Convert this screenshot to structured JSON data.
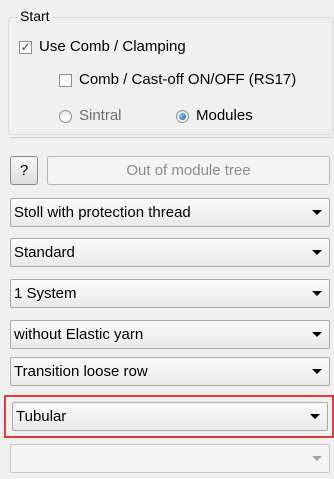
{
  "group": {
    "title": "Start",
    "use_comb_label": "Use Comb / Clamping",
    "use_comb_checked": true,
    "comb_castoff_label": "Comb / Cast-off ON/OFF (RS17)",
    "comb_castoff_checked": false,
    "radio_sintral_label": "Sintral",
    "radio_modules_label": "Modules",
    "selected_radio": "Modules"
  },
  "buttons": {
    "help_label": "?",
    "module_tree_label": "Out of module tree"
  },
  "dropdowns": [
    {
      "value": "Stoll with protection thread"
    },
    {
      "value": "Standard"
    },
    {
      "value": "1 System"
    },
    {
      "value": "without Elastic yarn"
    },
    {
      "value": "Transition loose row"
    },
    {
      "value": "Tubular"
    },
    {
      "value": ""
    }
  ],
  "icons": {
    "checkbox_mark": "✓",
    "dropdown": "chevron-down-icon"
  },
  "colors": {
    "highlight": "#e33b3b",
    "radio_selected": "#1d5aa7"
  }
}
